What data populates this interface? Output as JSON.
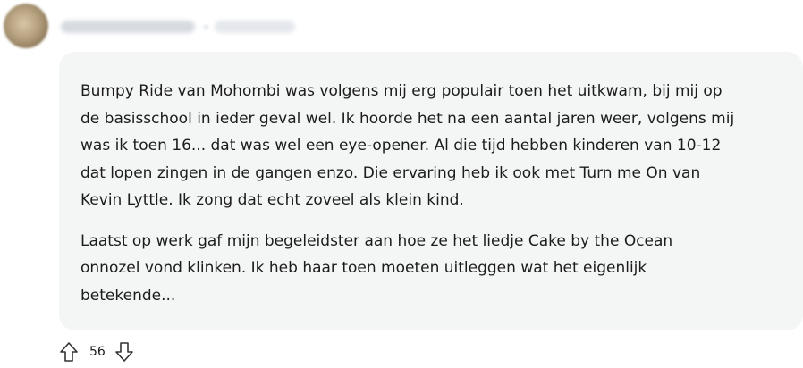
{
  "comment": {
    "author": {
      "name_blurred": true,
      "time_blurred": true
    },
    "paragraphs": [
      "Bumpy Ride van Mohombi was volgens mij erg populair toen het uitkwam, bij mij op\nde basisschool in ieder geval wel. Ik hoorde het na een aantal jaren weer, volgens mij\nwas ik toen 16... dat was wel een eye-opener. Al die tijd hebben kinderen van 10-12\ndat lopen zingen in de gangen enzo. Die ervaring heb ik ook met Turn me On van\nKevin Lyttle. Ik zong dat echt zoveel als klein kind.",
      "Laatst op werk gaf mijn begeleidster aan hoe ze het liedje Cake by the Ocean\nonnozel vond klinken. Ik heb haar toen moeten uitleggen wat het eigenlijk\nbetekende..."
    ],
    "votes": {
      "count": "56",
      "upvote_icon": "arrow-up-outline-icon",
      "downvote_icon": "arrow-down-outline-icon"
    }
  },
  "colors": {
    "comment_background": "#f4f5f5",
    "text": "#1c1c1c",
    "icon_stroke": "#333333"
  }
}
